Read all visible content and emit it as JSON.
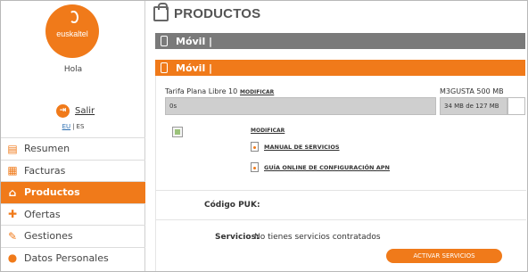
{
  "brand": {
    "logo_text": "euskaltel",
    "accent": "#f07a1a",
    "gray_bar": "#7a7a7a"
  },
  "sidebar": {
    "greeting": "Hola",
    "logout_label": "Salir",
    "lang": {
      "eu": "EU",
      "sep": "|",
      "es": "ES"
    },
    "items": [
      {
        "label": "Resumen",
        "icon": "clipboard-icon",
        "glyph": "▤"
      },
      {
        "label": "Facturas",
        "icon": "calculator-icon",
        "glyph": "▦"
      },
      {
        "label": "Productos",
        "icon": "bag-icon",
        "glyph": "⌂",
        "active": true
      },
      {
        "label": "Ofertas",
        "icon": "gift-icon",
        "glyph": "✚"
      },
      {
        "label": "Gestiones",
        "icon": "edit-icon",
        "glyph": "✎"
      },
      {
        "label": "Datos Personales",
        "icon": "user-icon",
        "glyph": "●"
      }
    ]
  },
  "main": {
    "title": "PRODUCTOS",
    "bars": {
      "gray_label": "Móvil |",
      "orange_label": "Móvil |"
    },
    "tariff": {
      "name": "Tarifa Plana Libre 10",
      "modify": "MODIFICAR",
      "field_value": "0s"
    },
    "data_plan": {
      "name": "M3GUSTA 500 MB",
      "usage": "34 MB de 127 MB"
    },
    "links": {
      "modificar": "MODIFICAR",
      "manual": "MANUAL DE SERVICIOS",
      "apn": "GUÍA ONLINE DE CONFIGURACIÓN APN"
    },
    "puk_label": "Código PUK:",
    "services_label": "Servicios:",
    "services_value": "No tienes servicios contratados",
    "activate_button": "ACTIVAR SERVICIOS"
  }
}
